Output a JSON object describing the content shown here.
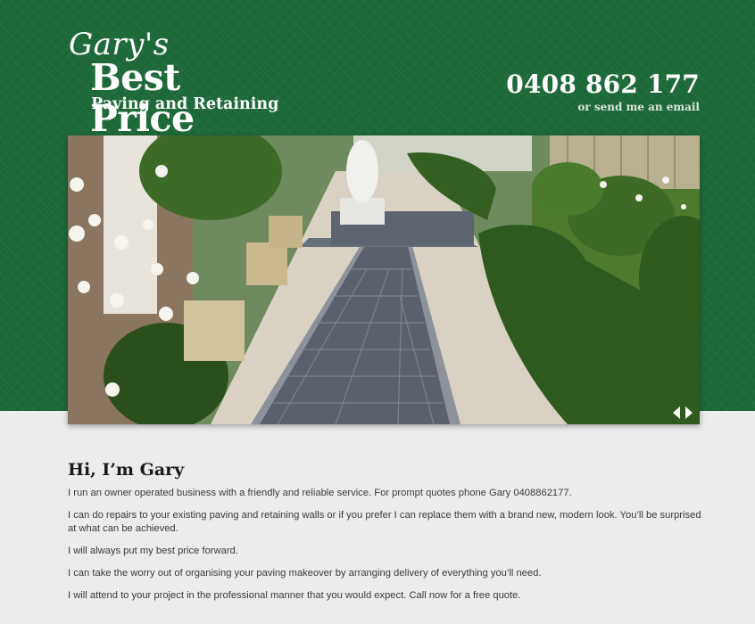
{
  "header": {
    "logo": {
      "script": "Gary's",
      "main": "Best Price",
      "sub": "Paving and Retaining"
    },
    "phone": "0408 862 177",
    "email_link": "or send me an email"
  },
  "slider": {
    "image_description_icon": "garden-path-photo",
    "prev_icon": "arrow-left-icon",
    "next_icon": "arrow-right-icon"
  },
  "main": {
    "heading": "Hi, I’m Gary",
    "paragraphs": [
      "I run an owner operated business with a friendly and reliable service. For prompt quotes phone Gary 0408862177.",
      "I can do repairs to your existing paving and retaining walls or if you prefer I can replace them with a brand new, modern look. You’ll be surprised at what can be achieved.",
      "I will always put my best price forward.",
      "I can take the worry out of organising your paving makeover by arranging delivery of everything you’ll need.",
      "I will attend to your project in the professional manner that you would expect. Call now for a free quote."
    ]
  },
  "colors": {
    "header_green": "#1e6a3b",
    "page_background": "#ececec",
    "text": "#3a3a3a"
  }
}
